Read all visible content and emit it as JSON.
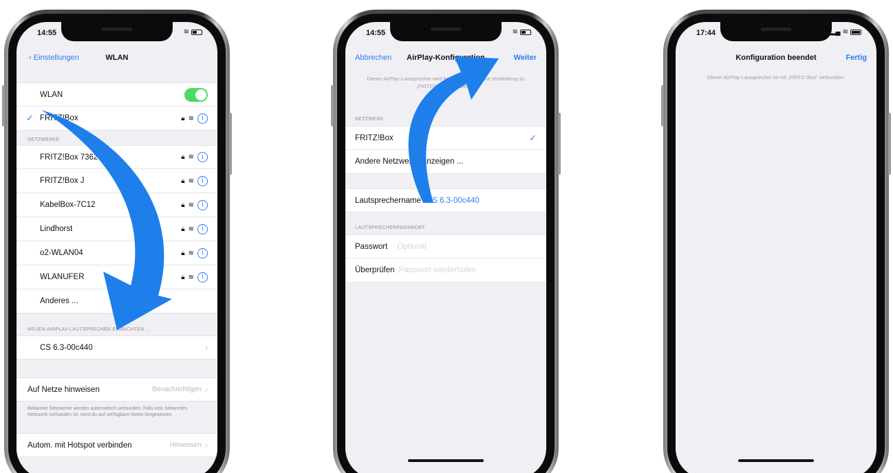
{
  "colors": {
    "accent": "#2f7ef0",
    "toggle_on": "#4cd964",
    "arrow": "#1e7fea"
  },
  "phone1": {
    "status_time": "14:55",
    "nav": {
      "back_label": "Einstellungen",
      "title": "WLAN"
    },
    "wlan_row": {
      "label": "WLAN",
      "toggle": "on"
    },
    "connected_network": "FRITZ!Box",
    "section_networks": "NETZWERKE",
    "networks": [
      "FRITZ!Box 7362 SL",
      "FRITZ!Box J",
      "KabelBox-7C12",
      "Lindhorst",
      "o2-WLAN04",
      "WLANUFER"
    ],
    "other_label": "Anderes ...",
    "section_airplay": "NEUEN AIRPLAY-LAUTSPRECHER EINRICHTEN ...",
    "airplay_device": "CS 6.3-00c440",
    "ask_join_label": "Auf Netze hinweisen",
    "ask_join_value": "Benachrichtigen",
    "ask_join_footnote": "Bekannte Netzwerke werden automatisch verbunden. Falls kein bekanntes Netzwerk vorhanden ist, wirst du auf verfügbare Netze hingewiesen.",
    "hotspot_label": "Autom. mit Hotspot verbinden",
    "hotspot_value": "Hinweisen"
  },
  "phone2": {
    "status_time": "14:55",
    "nav": {
      "cancel_label": "Abbrechen",
      "title": "AirPlay-Konfiguration",
      "next_label": "Weiter"
    },
    "description": "Dieser AirPlay-Lautsprecher wird konfiguriert, um eine Verbindung zu „FRITZ!Box“ herzustellen.",
    "section_network": "NETZWERK",
    "network_selected": "FRITZ!Box",
    "other_networks_label": "Andere Netzwerke anzeigen ...",
    "speaker_name_label": "Lautsprechername",
    "speaker_name_value": "CS 6.3-00c440",
    "section_password": "LAUTSPRECHERPASSWORT",
    "password_label": "Passwort",
    "password_placeholder": "Optional",
    "verify_label": "Überprüfen",
    "verify_placeholder": "Passwort wiederholen"
  },
  "phone3": {
    "status_time": "17:44",
    "nav": {
      "title": "Konfiguration beendet",
      "done_label": "Fertig"
    },
    "description": "Dieser AirPlay-Lautsprecher ist mit „FRITZ! Box“ verbunden."
  }
}
